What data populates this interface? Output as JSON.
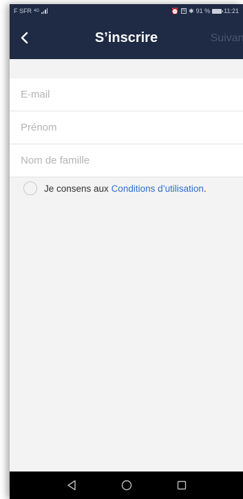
{
  "status_bar": {
    "carrier": "F SFR",
    "signal_label": "4G",
    "battery_text": "91 %",
    "time": "11:21"
  },
  "header": {
    "title": "S’inscrire",
    "next_label": "Suivant",
    "background": "#1f2a44"
  },
  "form": {
    "email_placeholder": "E-mail",
    "first_name_placeholder": "Prénom",
    "last_name_placeholder": "Nom de famille",
    "email_value": "",
    "first_name_value": "",
    "last_name_value": ""
  },
  "consent": {
    "prefix": "Je consens aux ",
    "link_text": "Conditions d’utilisation",
    "suffix": ".",
    "checked": false,
    "link_color": "#2c6fd1"
  },
  "nav_icons": [
    "back-triangle-icon",
    "home-circle-icon",
    "recents-square-icon"
  ]
}
